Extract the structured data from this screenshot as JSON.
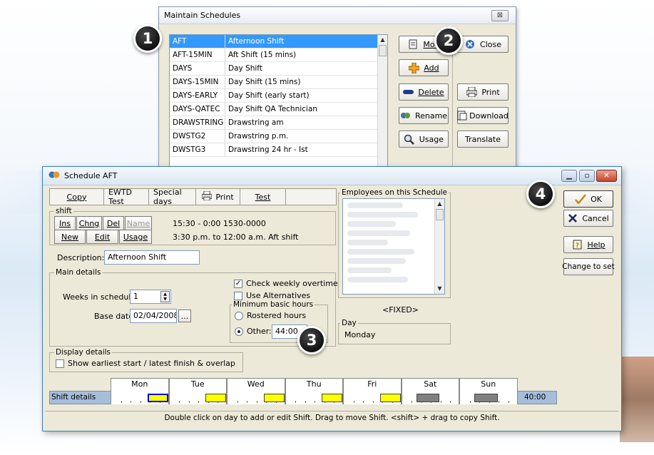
{
  "maintain": {
    "title": "Maintain Schedules",
    "close_x": "⊠",
    "list": [
      {
        "code": "AFT",
        "name": "Afternoon Shift"
      },
      {
        "code": "AFT-15MIN",
        "name": "Aft Shift (15 mins)"
      },
      {
        "code": "DAYS",
        "name": "Day Shift"
      },
      {
        "code": "DAYS-15MIN",
        "name": "Day Shift (15 mins)"
      },
      {
        "code": "DAYS-EARLY",
        "name": "Day Shift (early start)"
      },
      {
        "code": "DAYS-QATEC",
        "name": "Day Shift QA Technician"
      },
      {
        "code": "DRAWSTRING",
        "name": "Drawstring  am"
      },
      {
        "code": "DWSTG2",
        "name": "Drawstring p.m."
      },
      {
        "code": "DWSTG3",
        "name": "Drawstring 24 hr - Ist"
      }
    ],
    "buttons": {
      "modify": "Mod",
      "add": "Add",
      "delete": "Delete",
      "rename": "Rename",
      "usage": "Usage",
      "close": "Close",
      "print": "Print",
      "download": "Download",
      "translate": "Translate"
    }
  },
  "schedule": {
    "title": "Schedule  AFT",
    "tabs": {
      "copy": "Copy",
      "ewtd": "EWTD Test",
      "special": "Special days",
      "print": "Print",
      "test": "Test"
    },
    "shift": {
      "legend": "shift",
      "ins": "Ins",
      "chng": "Chng",
      "del": "Del",
      "name": "Name",
      "new": "New",
      "edit": "Edit",
      "usage": "Usage",
      "time1": "15:30 - 0:00  1530-0000",
      "time2": "3:30 p.m. to 12:00 a.m. Aft shift"
    },
    "description_label": "Description:",
    "description_value": "Afternoon Shift",
    "main": {
      "legend": "Main details",
      "weeks_label": "Weeks in schedule:",
      "weeks_value": "1",
      "base_label": "Base date:",
      "base_value": "02/04/2008",
      "browse": "...",
      "check_overtime": "Check weekly overtime",
      "use_alt": "Use Alternatives",
      "min_legend": "Minimum basic hours",
      "rostered": "Rostered hours",
      "other": "Other:",
      "other_value": "44:00"
    },
    "display": {
      "legend": "Display details",
      "show_earliest": "Show earliest start / latest finish & overlap"
    },
    "employees": {
      "legend": "Employees on this Schedule",
      "fixed": "<FIXED>"
    },
    "day": {
      "legend": "Day",
      "value": "Monday"
    },
    "buttons": {
      "ok": "OK",
      "cancel": "Cancel",
      "help": "Help",
      "change_to_set": "Change to set"
    },
    "grid": {
      "row_label": "Shift details",
      "total": "40:00",
      "days": [
        "Mon",
        "Tue",
        "Wed",
        "Thu",
        "Fri",
        "Sat",
        "Sun"
      ],
      "day_states": [
        "selected",
        "yellow",
        "yellow",
        "yellow",
        "yellow",
        "grey",
        "grey"
      ]
    },
    "status": "Double click on day to add or edit Shift.  Drag to move Shift.  <shift> + drag to copy Shift."
  },
  "callouts": [
    "1",
    "2",
    "3",
    "4"
  ],
  "colors": {
    "selection": "#3399ff",
    "shift_bar": "#ffff00",
    "weekend_bar": "#808080",
    "row_bar": "#a7bedb"
  }
}
